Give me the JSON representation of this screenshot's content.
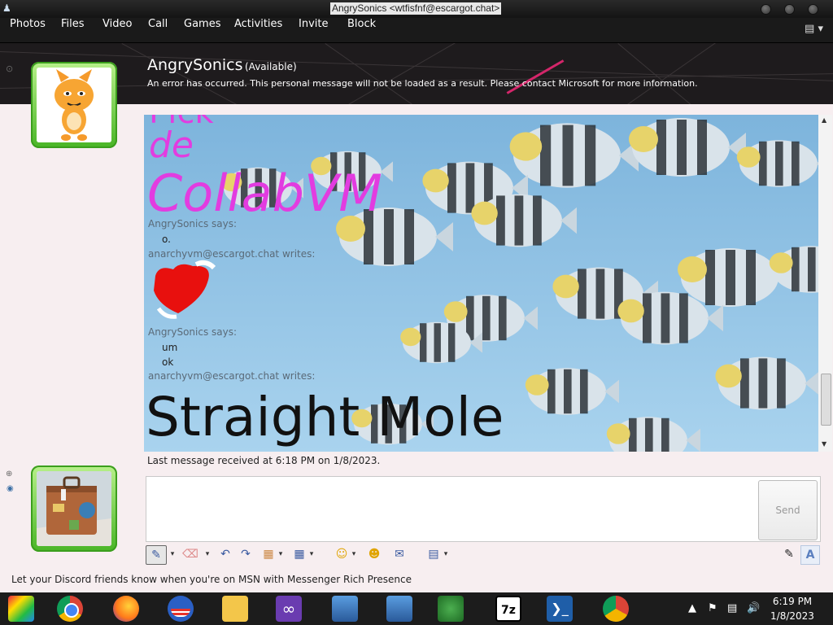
{
  "window": {
    "title": "AngrySonics <wtfisfnf@escargot.chat>"
  },
  "menu": [
    "Photos",
    "Files",
    "Video",
    "Call",
    "Games",
    "Activities",
    "Invite",
    "Block"
  ],
  "contact": {
    "name": "AngrySonics",
    "status": "(Available)",
    "personal_message": "An error has occurred. This personal message will not be loaded as a result. Please contact Microsoft for more information."
  },
  "conversation": {
    "ink_top_1": "Pick",
    "ink_top_2": "de",
    "ink_top_3": "CollabVM",
    "messages": [
      {
        "sender": "AngrySonics says:",
        "lines": [
          "o."
        ]
      },
      {
        "sender": "anarchyvm@escargot.chat writes:",
        "lines": []
      },
      {
        "sender": "AngrySonics says:",
        "lines": [
          "um",
          "ok"
        ]
      },
      {
        "sender": "anarchyvm@escargot.chat writes:",
        "lines": []
      }
    ],
    "ink_bottom": "Straight Mole"
  },
  "status_line": "Last message received at 6:18 PM on 1/8/2023.",
  "send_label": "Send",
  "promo": "Let your Discord friends know when you're on MSN with Messenger Rich Presence",
  "clock": {
    "time": "6:19 PM",
    "date": "1/8/2023"
  },
  "colors": {
    "accent_green": "#49b526",
    "ink_magenta": "#e23ce0",
    "heart_red": "#e8100e"
  }
}
